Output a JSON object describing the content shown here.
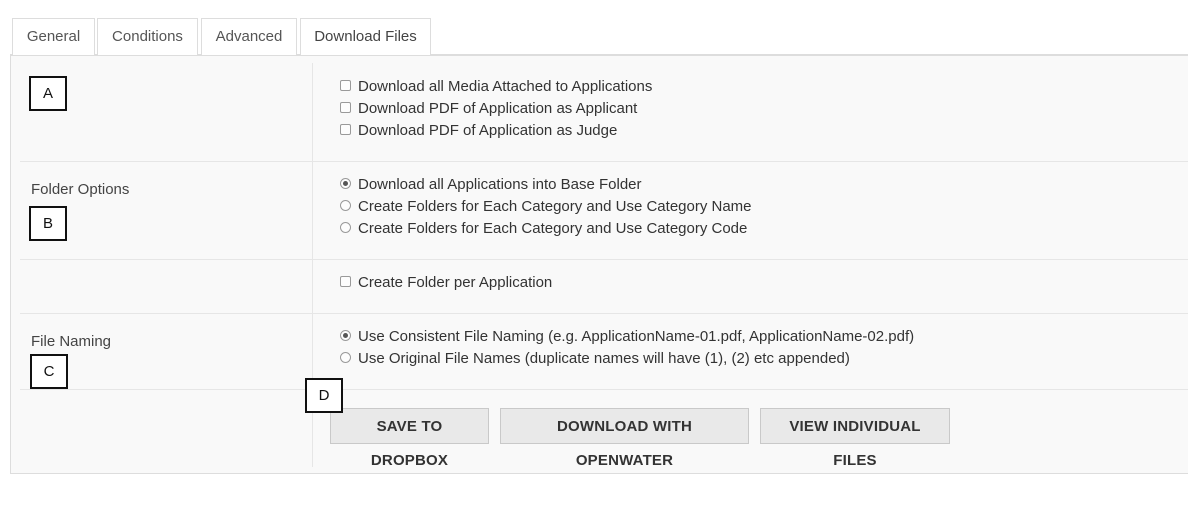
{
  "tabs": [
    {
      "label": "General",
      "active": false
    },
    {
      "label": "Conditions",
      "active": false
    },
    {
      "label": "Advanced",
      "active": false
    },
    {
      "label": "Download Files",
      "active": true
    }
  ],
  "markers": {
    "a": "A",
    "b": "B",
    "c": "C",
    "d": "D"
  },
  "media_section": {
    "label": "",
    "options": [
      {
        "label": "Download all Media Attached to Applications",
        "checked": false
      },
      {
        "label": "Download PDF of Application as Applicant",
        "checked": false
      },
      {
        "label": "Download PDF of Application as Judge",
        "checked": false
      }
    ]
  },
  "folder_options": {
    "label": "Folder Options",
    "options": [
      {
        "label": "Download all Applications into Base Folder",
        "selected": true
      },
      {
        "label": "Create Folders for Each Category and Use Category Name",
        "selected": false
      },
      {
        "label": "Create Folders for Each Category and Use Category Code",
        "selected": false
      }
    ]
  },
  "folder_per_app": {
    "label": "Create Folder per Application",
    "checked": false
  },
  "file_naming": {
    "label": "File Naming",
    "options": [
      {
        "label": "Use Consistent File Naming (e.g. ApplicationName-01.pdf, ApplicationName-02.pdf)",
        "selected": true
      },
      {
        "label": "Use Original File Names (duplicate names will have (1), (2) etc appended)",
        "selected": false
      }
    ]
  },
  "actions": {
    "save_dropbox": "SAVE TO DROPBOX",
    "download_openwater": "DOWNLOAD WITH OPENWATER",
    "view_individual": "VIEW INDIVIDUAL FILES"
  }
}
